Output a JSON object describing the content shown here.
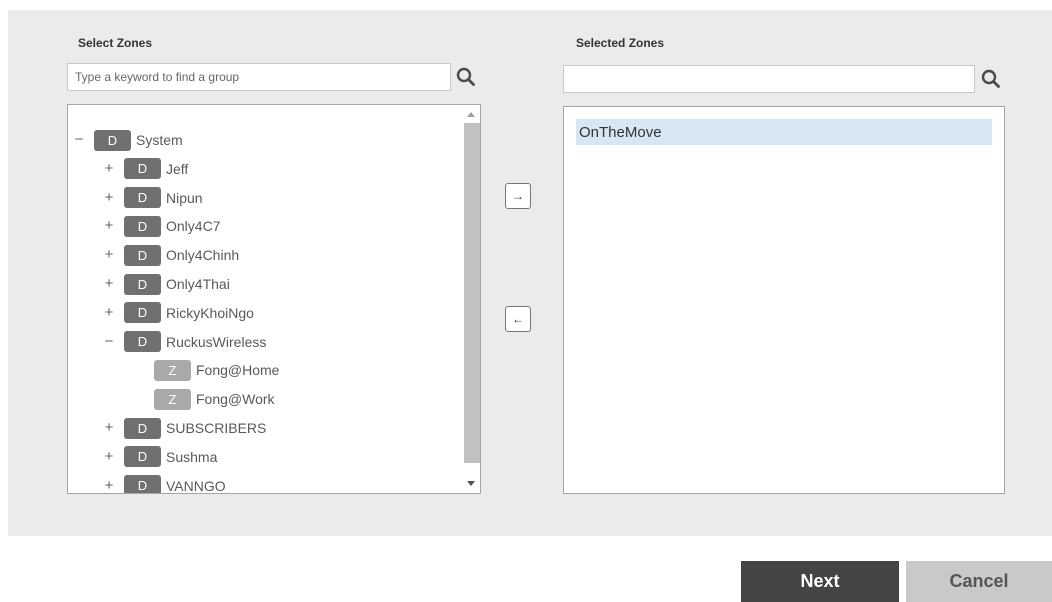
{
  "select_zones": {
    "label": "Select Zones",
    "search_placeholder": "Type a keyword to find a group",
    "search_icon": "search-icon",
    "tree": [
      {
        "toggle": "−",
        "type": "D",
        "label": "System"
      },
      {
        "toggle": "+",
        "type": "D",
        "label": "Jeff"
      },
      {
        "toggle": "+",
        "type": "D",
        "label": "Nipun"
      },
      {
        "toggle": "+",
        "type": "D",
        "label": "Only4C7"
      },
      {
        "toggle": "+",
        "type": "D",
        "label": "Only4Chinh"
      },
      {
        "toggle": "+",
        "type": "D",
        "label": "Only4Thai"
      },
      {
        "toggle": "+",
        "type": "D",
        "label": "RickyKhoiNgo"
      },
      {
        "toggle": "−",
        "type": "D",
        "label": "RuckusWireless"
      },
      {
        "toggle": "",
        "type": "Z",
        "label": "Fong@Home"
      },
      {
        "toggle": "",
        "type": "Z",
        "label": "Fong@Work"
      },
      {
        "toggle": "+",
        "type": "D",
        "label": "SUBSCRIBERS"
      },
      {
        "toggle": "+",
        "type": "D",
        "label": "Sushma"
      },
      {
        "toggle": "+",
        "type": "D",
        "label": "VANNGO"
      }
    ]
  },
  "move_buttons": {
    "add_icon": "→",
    "remove_icon": "←"
  },
  "selected_zones": {
    "label": "Selected Zones",
    "search_value": "",
    "search_icon": "search-icon",
    "items": [
      "OnTheMove"
    ]
  },
  "footer": {
    "next_label": "Next",
    "cancel_label": "Cancel"
  }
}
